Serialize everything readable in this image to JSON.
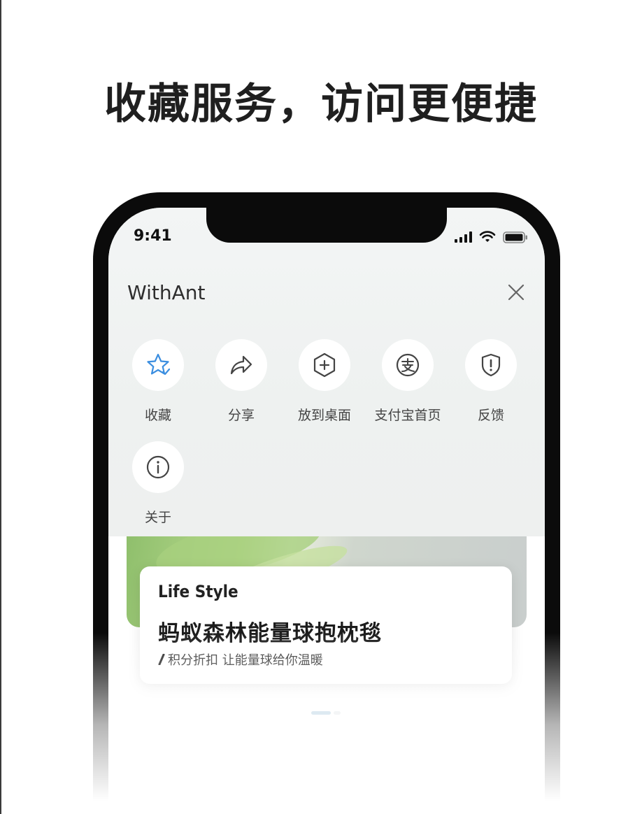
{
  "headline": "收藏服务，访问更便捷",
  "status_bar": {
    "time": "9:41"
  },
  "sheet": {
    "title": "WithAnt",
    "actions": [
      {
        "label": "收藏",
        "icon": "star-check-icon"
      },
      {
        "label": "分享",
        "icon": "share-arrow-icon"
      },
      {
        "label": "放到桌面",
        "icon": "add-hexagon-icon"
      },
      {
        "label": "支付宝首页",
        "icon": "alipay-icon"
      },
      {
        "label": "反馈",
        "icon": "shield-alert-icon"
      },
      {
        "label": "关于",
        "icon": "info-icon"
      }
    ]
  },
  "card": {
    "tag": "Life Style",
    "title": "蚂蚁森林能量球抱枕毯",
    "subtitle": "积分折扣 让能量球给你温暖"
  },
  "colors": {
    "accent": "#3b8ee0",
    "dot_active": "#a9c9dc"
  }
}
